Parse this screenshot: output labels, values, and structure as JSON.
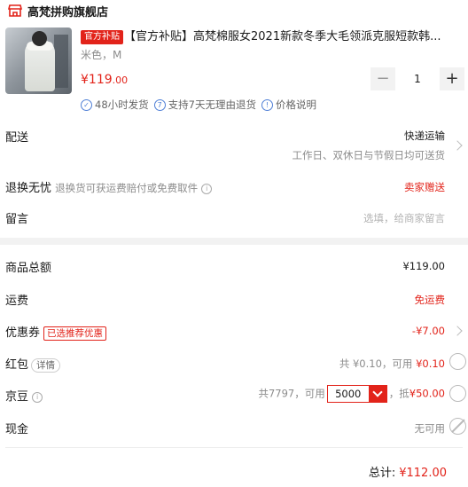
{
  "shop": {
    "name": "高梵拼购旗舰店"
  },
  "product": {
    "tag": "官方补贴",
    "title": "【官方补贴】高梵棉服女2021新款冬季大毛领派克服短款韩...",
    "spec": "米色，M",
    "price_main": "¥119",
    "price_decimal": ".00",
    "quantity": "1",
    "services": [
      "48小时发货",
      "支持7天无理由退货",
      "价格说明"
    ]
  },
  "delivery": {
    "label": "配送",
    "method": "快递运输",
    "schedule": "工作日、双休日与节假日均可送货"
  },
  "return": {
    "label": "退换无忧",
    "desc": "退换货可获运费赔付或免费取件",
    "value": "卖家赠送"
  },
  "message": {
    "label": "留言",
    "placeholder": "选填，给商家留言"
  },
  "summary": {
    "subtotal_label": "商品总额",
    "subtotal": "¥119.00",
    "shipping_label": "运费",
    "shipping": "免运费",
    "coupon_label": "优惠券",
    "coupon_tag": "已选推荐优惠",
    "coupon_value": "-¥7.00",
    "redpacket_label": "红包",
    "redpacket_detail": "详情",
    "redpacket_total": "共 ¥0.10，可用",
    "redpacket_available": "¥0.10",
    "bean_label": "京豆",
    "bean_total": "共7797，可用",
    "bean_value": "5000",
    "bean_offset_prefix": "，抵",
    "bean_offset": "¥50.00",
    "cash_label": "现金",
    "cash_value": "无可用",
    "total_label": "总计:",
    "total_value": "¥112.00"
  },
  "colors": {
    "accent": "#e2231a",
    "service_blue": "#4f7fd6"
  },
  "icons": {
    "shop": "store-icon",
    "info": "info-icon",
    "service": "shield-check-icon"
  }
}
